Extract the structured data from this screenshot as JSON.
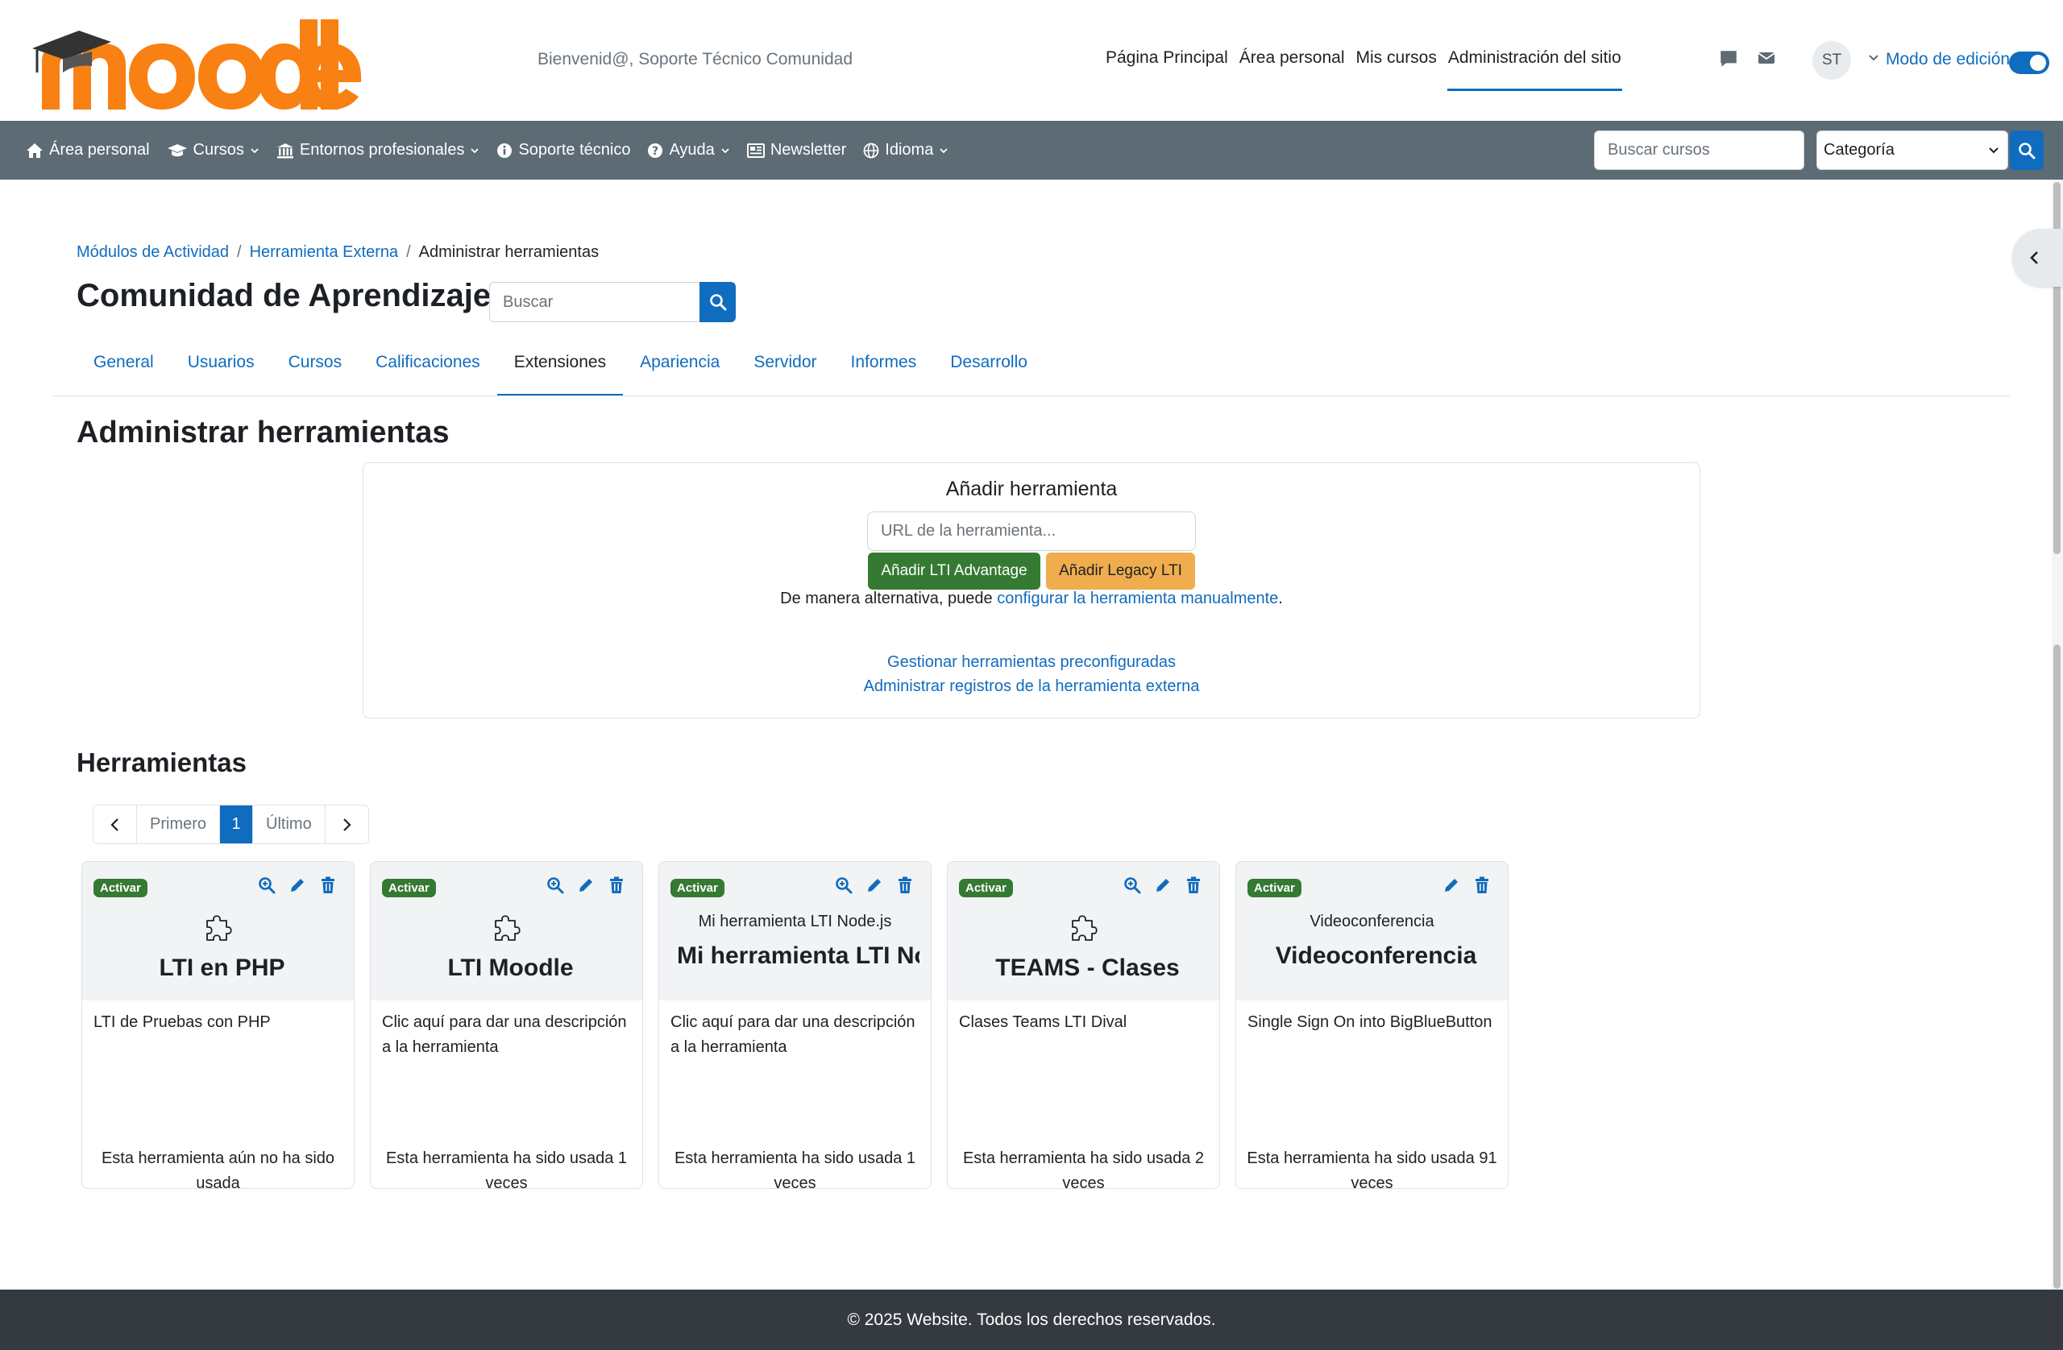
{
  "header": {
    "logo_text": "moodle",
    "welcome": "Bienvenid@, Soporte Técnico Comunidad",
    "primary_nav": [
      "Página Principal",
      "Área personal",
      "Mis cursos",
      "Administración del sitio"
    ],
    "active_nav": "Administración del sitio",
    "user_initials": "ST",
    "edit_mode_label": "Modo de edición",
    "edit_mode_on": true
  },
  "navbar": {
    "items": [
      {
        "label": "Área personal",
        "icon": "home-icon",
        "dropdown": false
      },
      {
        "label": "Cursos",
        "icon": "graduation-cap-icon",
        "dropdown": true
      },
      {
        "label": "Entornos profesionales",
        "icon": "institution-icon",
        "dropdown": true
      },
      {
        "label": "Soporte técnico",
        "icon": "info-icon",
        "dropdown": false
      },
      {
        "label": "Ayuda",
        "icon": "question-icon",
        "dropdown": true
      },
      {
        "label": "Newsletter",
        "icon": "newspaper-icon",
        "dropdown": false
      },
      {
        "label": "Idioma",
        "icon": "globe-icon",
        "dropdown": true
      }
    ],
    "search_placeholder": "Buscar cursos",
    "category_selected": "Categoría"
  },
  "breadcrumb": [
    "Módulos de Actividad",
    "Herramienta Externa",
    "Administrar herramientas"
  ],
  "site_title": "Comunidad de Aprendizaje",
  "admin_search_placeholder": "Buscar",
  "tabs": [
    "General",
    "Usuarios",
    "Cursos",
    "Calificaciones",
    "Extensiones",
    "Apariencia",
    "Servidor",
    "Informes",
    "Desarrollo"
  ],
  "active_tab": "Extensiones",
  "main_heading": "Administrar herramientas",
  "add_panel": {
    "title": "Añadir herramienta",
    "url_placeholder": "URL de la herramienta...",
    "btn_advantage": "Añadir LTI Advantage",
    "btn_legacy": "Añadir Legacy LTI",
    "alt_text_prefix": "De manera alternativa, puede ",
    "alt_link": "configurar la herramienta manualmente",
    "alt_text_suffix": ".",
    "link_preconfigured": "Gestionar herramientas preconfiguradas",
    "link_registrations": "Administrar registros de la herramienta externa"
  },
  "tools_heading": "Herramientas",
  "pagination": {
    "first": "Primero",
    "current": "1",
    "last": "Último"
  },
  "tools": [
    {
      "badge": "Activar",
      "title": "LTI en PHP",
      "image_alt": "",
      "has_view": true,
      "description": "LTI de Pruebas con PHP",
      "usage": "Esta herramienta aún no ha sido usada"
    },
    {
      "badge": "Activar",
      "title": "LTI Moodle",
      "image_alt": "",
      "has_view": true,
      "description": "Clic aquí para dar una descripción a la herramienta",
      "usage": "Esta herramienta ha sido usada 1 veces"
    },
    {
      "badge": "Activar",
      "title": "Mi herramienta LTI Node.js",
      "image_alt": "Mi herramienta LTI Node.js",
      "has_view": true,
      "description": "Clic aquí para dar una descripción a la herramienta",
      "usage": "Esta herramienta ha sido usada 1 veces"
    },
    {
      "badge": "Activar",
      "title": "TEAMS - Clases",
      "image_alt": "",
      "has_view": true,
      "description": "Clases Teams LTI Dival",
      "usage": "Esta herramienta ha sido usada 2 veces"
    },
    {
      "badge": "Activar",
      "title": "Videoconferencia",
      "image_alt": "Videoconferencia",
      "has_view": false,
      "description": "Single Sign On into BigBlueButton",
      "usage": "Esta herramienta ha sido usada 91 veces"
    }
  ],
  "footer": "© 2025 Website. Todos los derechos reservados.",
  "colors": {
    "brand_orange": "#f98012",
    "link_blue": "#0f6cbf",
    "navbar_gray": "#5d6b75",
    "success_green": "#357a32",
    "warning_orange": "#f0ad4e",
    "footer_dark": "#343a40"
  }
}
